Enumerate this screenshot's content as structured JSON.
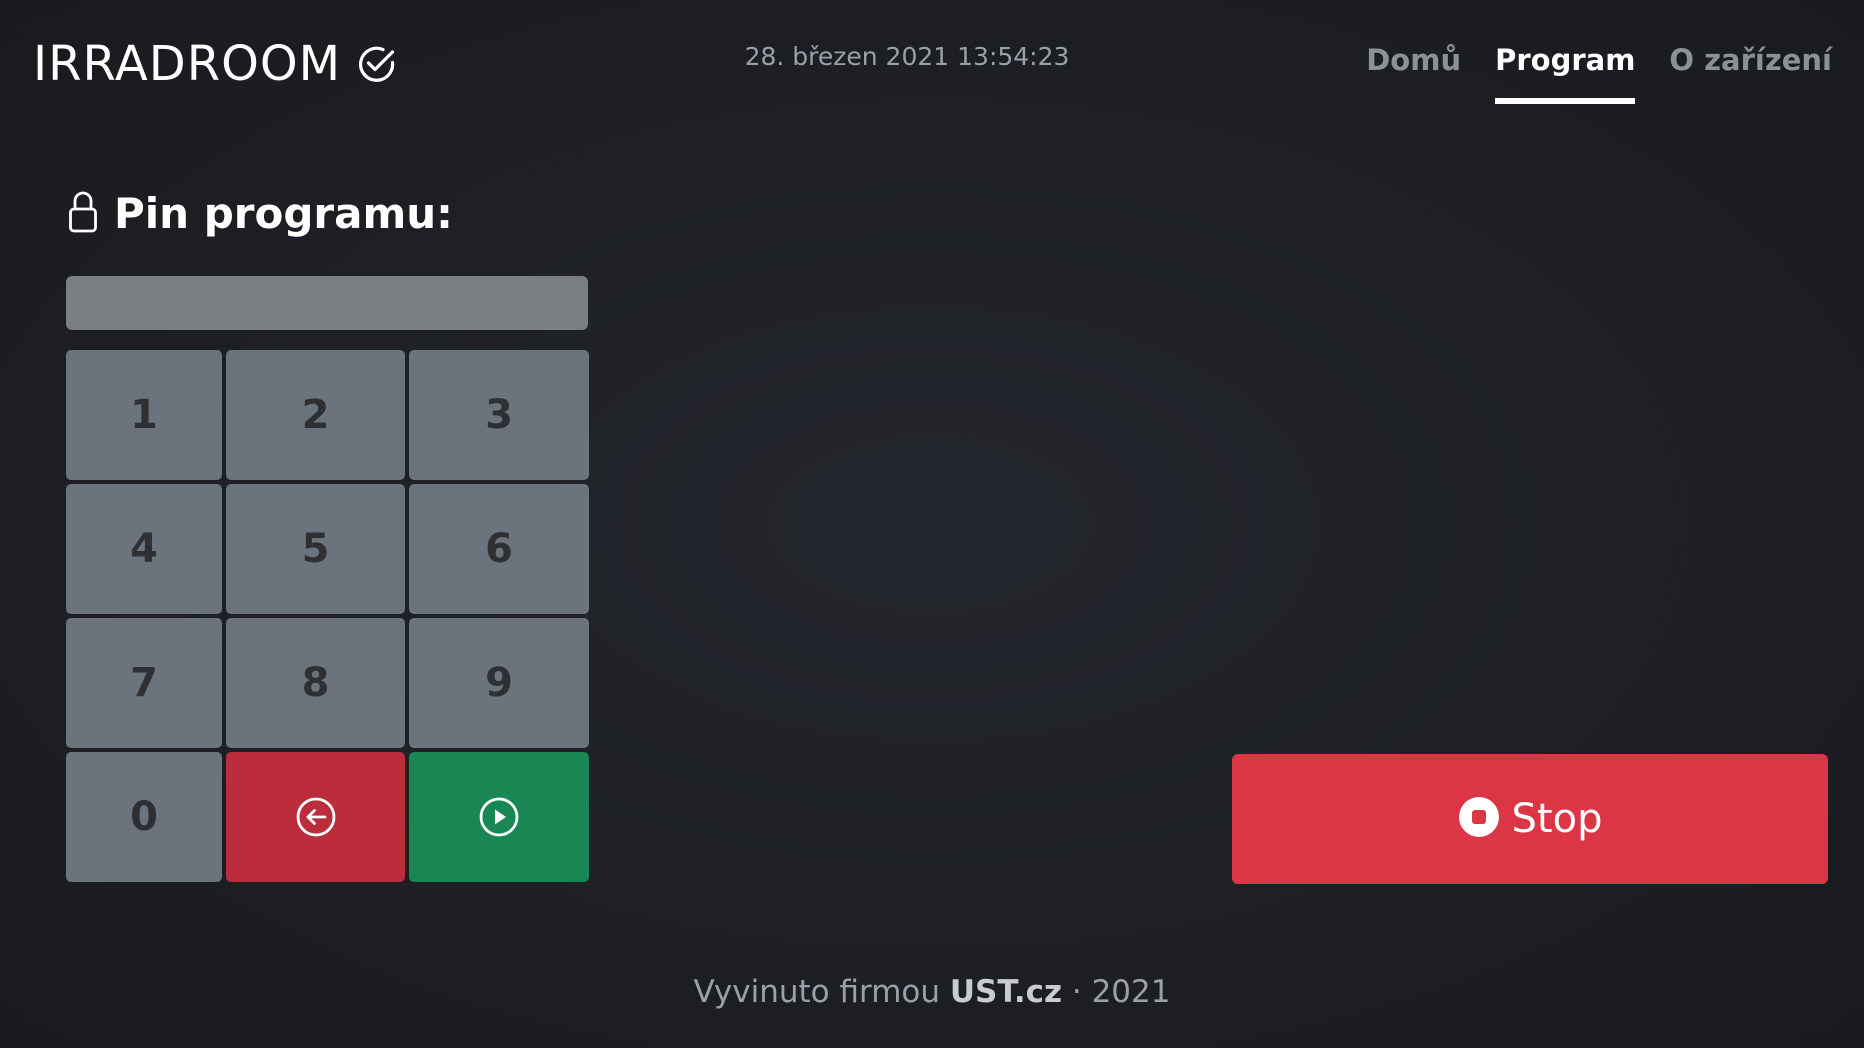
{
  "header": {
    "brand": "IRRADROOM",
    "brand_icon": "check-circle-icon",
    "datetime": "28. březen 2021 13:54:23",
    "nav": [
      {
        "label": "Domů",
        "active": false
      },
      {
        "label": "Program",
        "active": true
      },
      {
        "label": "O zařízení",
        "active": false
      }
    ]
  },
  "pin": {
    "title": "Pin programu:",
    "title_icon": "lock-icon",
    "input_value": "",
    "keys": [
      "1",
      "2",
      "3",
      "4",
      "5",
      "6",
      "7",
      "8",
      "9",
      "0"
    ],
    "backspace_icon": "arrow-left-circle-icon",
    "submit_icon": "play-circle-icon"
  },
  "stop": {
    "label": "Stop",
    "icon": "stop-circle-icon"
  },
  "footer": {
    "prefix": "Vyvinuto firmou",
    "company": "UST.cz",
    "suffix": "· 2021"
  },
  "colors": {
    "background": "#1d1f24",
    "key": "#6b737c",
    "danger": "#dc3545",
    "backspace": "#bb2d3b",
    "success": "#198754",
    "input": "#7b7e82"
  }
}
